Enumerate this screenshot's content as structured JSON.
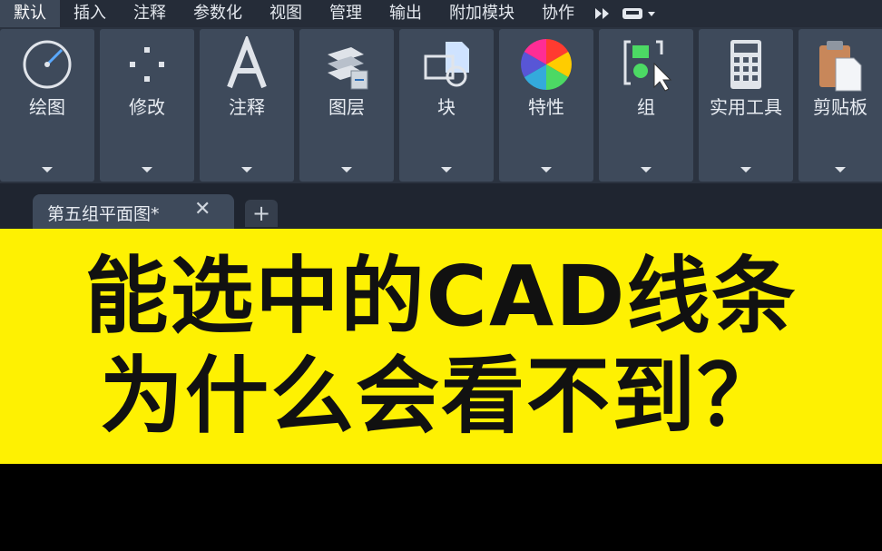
{
  "menu": {
    "tabs": [
      {
        "label": "默认",
        "active": true
      },
      {
        "label": "插入"
      },
      {
        "label": "注释"
      },
      {
        "label": "参数化"
      },
      {
        "label": "视图"
      },
      {
        "label": "管理"
      },
      {
        "label": "输出"
      },
      {
        "label": "附加模块"
      },
      {
        "label": "协作"
      }
    ]
  },
  "ribbon": {
    "panels": [
      {
        "label": "绘图",
        "icon": "draw-circle-icon"
      },
      {
        "label": "修改",
        "icon": "modify-move-icon"
      },
      {
        "label": "注释",
        "icon": "annotation-text-icon"
      },
      {
        "label": "图层",
        "icon": "layers-icon"
      },
      {
        "label": "块",
        "icon": "block-icon"
      },
      {
        "label": "特性",
        "icon": "color-wheel-icon"
      },
      {
        "label": "组",
        "icon": "group-icon"
      },
      {
        "label": "实用工具",
        "icon": "calculator-icon"
      },
      {
        "label": "剪贴板",
        "icon": "clipboard-icon"
      }
    ]
  },
  "document": {
    "tab_title": "第五组平面图*",
    "close_glyph": "✕",
    "add_glyph": "+"
  },
  "banner": {
    "line1": "能选中的CAD线条",
    "line2": "为什么会看不到？",
    "background": "#fef102",
    "text_color": "#111111"
  }
}
